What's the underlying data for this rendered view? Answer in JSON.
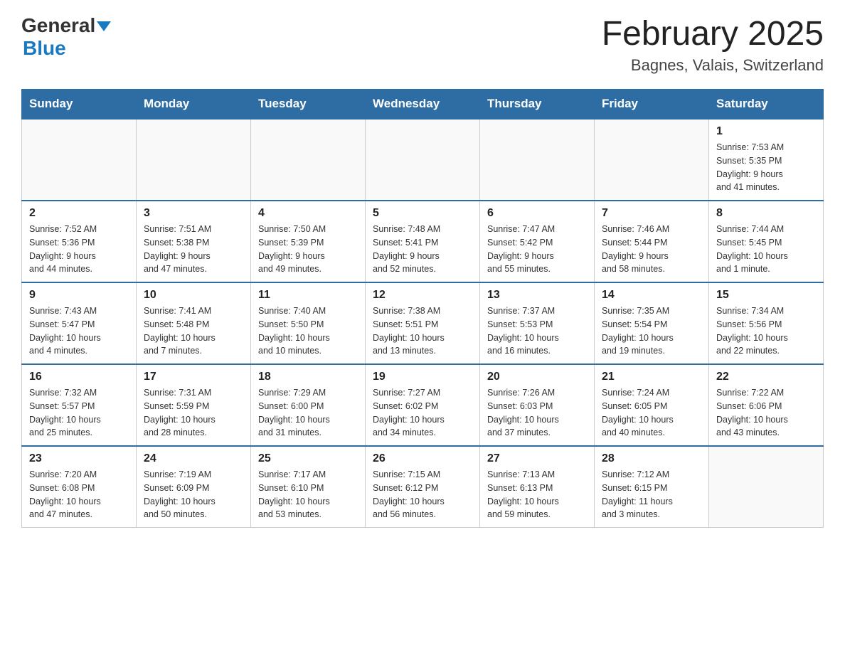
{
  "header": {
    "logo_general": "General",
    "logo_blue": "Blue",
    "month_title": "February 2025",
    "location": "Bagnes, Valais, Switzerland"
  },
  "weekdays": [
    "Sunday",
    "Monday",
    "Tuesday",
    "Wednesday",
    "Thursday",
    "Friday",
    "Saturday"
  ],
  "weeks": [
    [
      {
        "day": "",
        "info": ""
      },
      {
        "day": "",
        "info": ""
      },
      {
        "day": "",
        "info": ""
      },
      {
        "day": "",
        "info": ""
      },
      {
        "day": "",
        "info": ""
      },
      {
        "day": "",
        "info": ""
      },
      {
        "day": "1",
        "info": "Sunrise: 7:53 AM\nSunset: 5:35 PM\nDaylight: 9 hours\nand 41 minutes."
      }
    ],
    [
      {
        "day": "2",
        "info": "Sunrise: 7:52 AM\nSunset: 5:36 PM\nDaylight: 9 hours\nand 44 minutes."
      },
      {
        "day": "3",
        "info": "Sunrise: 7:51 AM\nSunset: 5:38 PM\nDaylight: 9 hours\nand 47 minutes."
      },
      {
        "day": "4",
        "info": "Sunrise: 7:50 AM\nSunset: 5:39 PM\nDaylight: 9 hours\nand 49 minutes."
      },
      {
        "day": "5",
        "info": "Sunrise: 7:48 AM\nSunset: 5:41 PM\nDaylight: 9 hours\nand 52 minutes."
      },
      {
        "day": "6",
        "info": "Sunrise: 7:47 AM\nSunset: 5:42 PM\nDaylight: 9 hours\nand 55 minutes."
      },
      {
        "day": "7",
        "info": "Sunrise: 7:46 AM\nSunset: 5:44 PM\nDaylight: 9 hours\nand 58 minutes."
      },
      {
        "day": "8",
        "info": "Sunrise: 7:44 AM\nSunset: 5:45 PM\nDaylight: 10 hours\nand 1 minute."
      }
    ],
    [
      {
        "day": "9",
        "info": "Sunrise: 7:43 AM\nSunset: 5:47 PM\nDaylight: 10 hours\nand 4 minutes."
      },
      {
        "day": "10",
        "info": "Sunrise: 7:41 AM\nSunset: 5:48 PM\nDaylight: 10 hours\nand 7 minutes."
      },
      {
        "day": "11",
        "info": "Sunrise: 7:40 AM\nSunset: 5:50 PM\nDaylight: 10 hours\nand 10 minutes."
      },
      {
        "day": "12",
        "info": "Sunrise: 7:38 AM\nSunset: 5:51 PM\nDaylight: 10 hours\nand 13 minutes."
      },
      {
        "day": "13",
        "info": "Sunrise: 7:37 AM\nSunset: 5:53 PM\nDaylight: 10 hours\nand 16 minutes."
      },
      {
        "day": "14",
        "info": "Sunrise: 7:35 AM\nSunset: 5:54 PM\nDaylight: 10 hours\nand 19 minutes."
      },
      {
        "day": "15",
        "info": "Sunrise: 7:34 AM\nSunset: 5:56 PM\nDaylight: 10 hours\nand 22 minutes."
      }
    ],
    [
      {
        "day": "16",
        "info": "Sunrise: 7:32 AM\nSunset: 5:57 PM\nDaylight: 10 hours\nand 25 minutes."
      },
      {
        "day": "17",
        "info": "Sunrise: 7:31 AM\nSunset: 5:59 PM\nDaylight: 10 hours\nand 28 minutes."
      },
      {
        "day": "18",
        "info": "Sunrise: 7:29 AM\nSunset: 6:00 PM\nDaylight: 10 hours\nand 31 minutes."
      },
      {
        "day": "19",
        "info": "Sunrise: 7:27 AM\nSunset: 6:02 PM\nDaylight: 10 hours\nand 34 minutes."
      },
      {
        "day": "20",
        "info": "Sunrise: 7:26 AM\nSunset: 6:03 PM\nDaylight: 10 hours\nand 37 minutes."
      },
      {
        "day": "21",
        "info": "Sunrise: 7:24 AM\nSunset: 6:05 PM\nDaylight: 10 hours\nand 40 minutes."
      },
      {
        "day": "22",
        "info": "Sunrise: 7:22 AM\nSunset: 6:06 PM\nDaylight: 10 hours\nand 43 minutes."
      }
    ],
    [
      {
        "day": "23",
        "info": "Sunrise: 7:20 AM\nSunset: 6:08 PM\nDaylight: 10 hours\nand 47 minutes."
      },
      {
        "day": "24",
        "info": "Sunrise: 7:19 AM\nSunset: 6:09 PM\nDaylight: 10 hours\nand 50 minutes."
      },
      {
        "day": "25",
        "info": "Sunrise: 7:17 AM\nSunset: 6:10 PM\nDaylight: 10 hours\nand 53 minutes."
      },
      {
        "day": "26",
        "info": "Sunrise: 7:15 AM\nSunset: 6:12 PM\nDaylight: 10 hours\nand 56 minutes."
      },
      {
        "day": "27",
        "info": "Sunrise: 7:13 AM\nSunset: 6:13 PM\nDaylight: 10 hours\nand 59 minutes."
      },
      {
        "day": "28",
        "info": "Sunrise: 7:12 AM\nSunset: 6:15 PM\nDaylight: 11 hours\nand 3 minutes."
      },
      {
        "day": "",
        "info": ""
      }
    ]
  ]
}
